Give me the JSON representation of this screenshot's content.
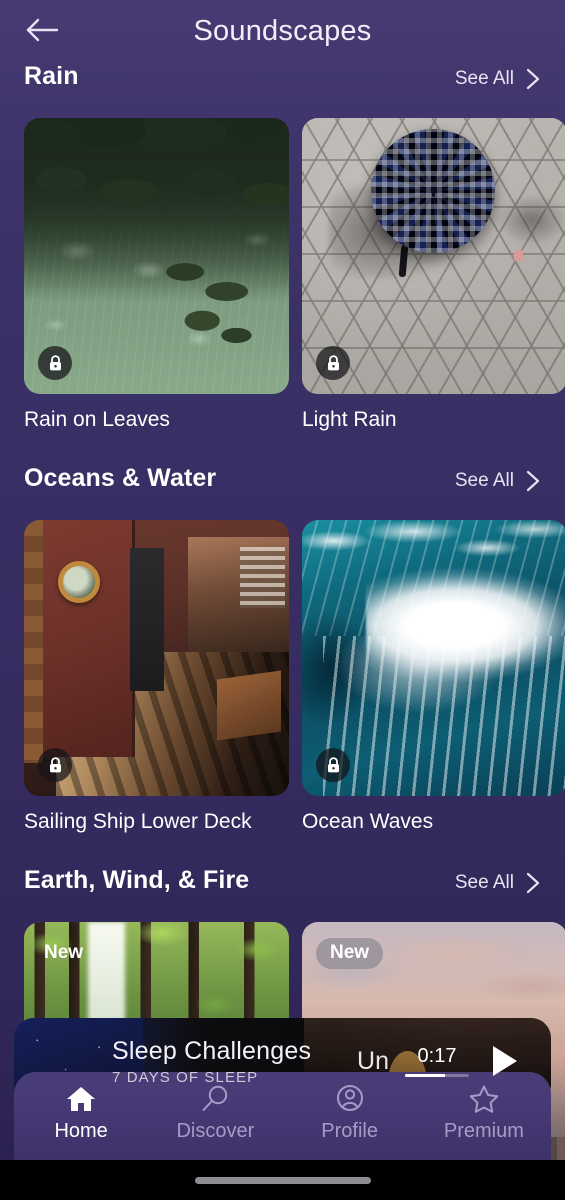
{
  "header": {
    "back_icon": "arrow-left-icon",
    "title": "Soundscapes"
  },
  "see_all_label": "See All",
  "chevron_icon": "chevron-right-icon",
  "lock_icon": "lock-icon",
  "new_badge_label": "New",
  "sections": [
    {
      "title": "Rain",
      "see_all": "See All",
      "cards": [
        {
          "title": "Rain on Leaves",
          "locked": true,
          "badge": null,
          "art": "rain-on-leaves"
        },
        {
          "title": "Light Rain",
          "locked": true,
          "badge": null,
          "art": "light-rain-umbrella"
        }
      ]
    },
    {
      "title": "Oceans & Water",
      "see_all": "See All",
      "cards": [
        {
          "title": "Sailing Ship Lower Deck",
          "locked": true,
          "badge": null,
          "art": "sailing-ship-deck"
        },
        {
          "title": "Ocean Waves",
          "locked": true,
          "badge": null,
          "art": "ocean-waves"
        }
      ]
    },
    {
      "title": "Earth, Wind, & Fire",
      "see_all": "See All",
      "cards": [
        {
          "title": "",
          "locked": false,
          "badge": "New",
          "art": "forest-waterfall"
        },
        {
          "title": "",
          "locked": false,
          "badge": "New",
          "art": "city-sunset"
        }
      ]
    }
  ],
  "player": {
    "title": "Sleep Challenges",
    "subtitle": "7 DAYS OF SLEEP",
    "clipped_text": "Un",
    "time": "0:17",
    "progress_percent": 62,
    "play_icon": "play-icon"
  },
  "nav": {
    "items": [
      {
        "label": "Home",
        "icon": "home-icon",
        "active": true
      },
      {
        "label": "Discover",
        "icon": "search-icon",
        "active": false
      },
      {
        "label": "Profile",
        "icon": "person-icon",
        "active": false
      },
      {
        "label": "Premium",
        "icon": "star-icon",
        "active": false
      }
    ]
  },
  "colors": {
    "background_top": "#483b73",
    "background_bottom": "#2a2150",
    "nav_background": "#463975",
    "accent_text": "#ffffff",
    "muted_text": "#a79bc6"
  }
}
